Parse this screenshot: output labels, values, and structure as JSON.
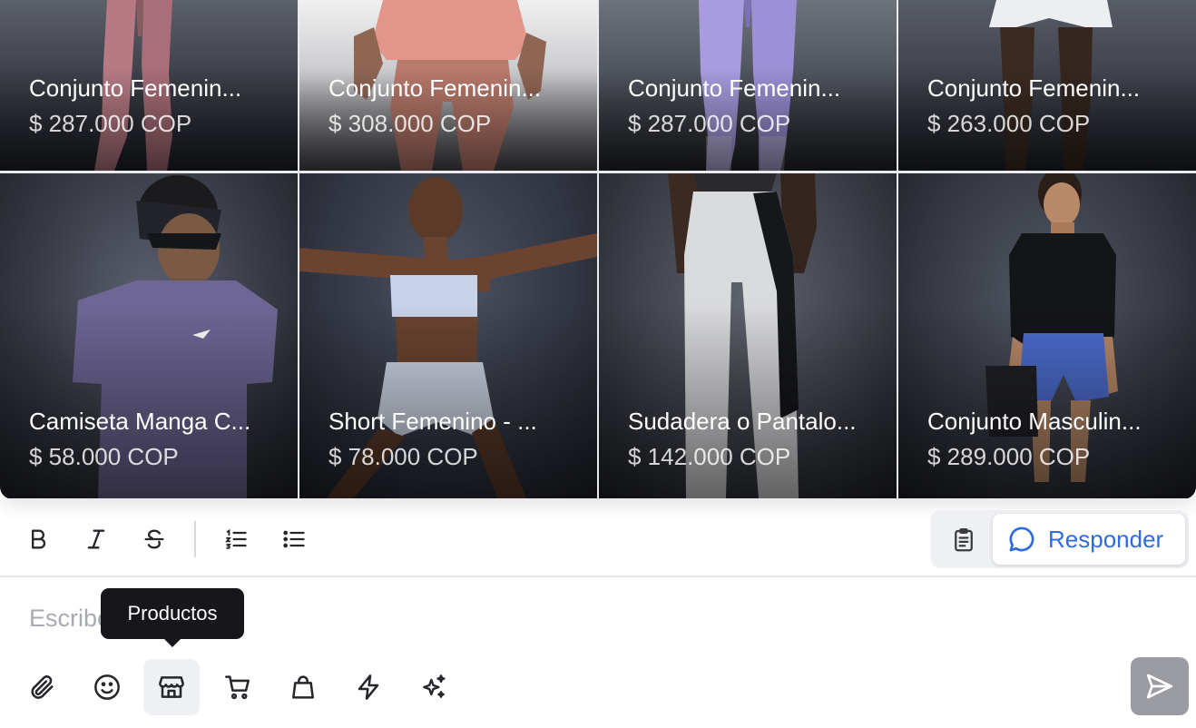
{
  "products": [
    {
      "name": "Conjunto Femenin...",
      "price": "$ 287.000 COP"
    },
    {
      "name": "Conjunto Femenin...",
      "price": "$ 308.000 COP"
    },
    {
      "name": "Conjunto Femenin...",
      "price": "$ 287.000 COP"
    },
    {
      "name": "Conjunto Femenin...",
      "price": "$ 263.000 COP"
    },
    {
      "name": "Camiseta Manga C...",
      "price": "$ 58.000 COP"
    },
    {
      "name": "Short Femenino - ...",
      "price": "$ 78.000 COP"
    },
    {
      "name": "Sudadera o Pantalo...",
      "price": "$ 142.000 COP"
    },
    {
      "name": "Conjunto Masculin...",
      "price": "$ 289.000 COP"
    }
  ],
  "toolbar": {
    "format_icons": [
      "bold-icon",
      "italic-icon",
      "strikethrough-icon",
      "numbered-list-icon",
      "bulleted-list-icon"
    ],
    "notes_icon": "clipboard-icon",
    "reply_label": "Responder",
    "reply_icon": "chat-bubble-icon"
  },
  "composer": {
    "placeholder": "Escribe un mensaje",
    "tooltip": "Productos",
    "action_icons": [
      "paperclip-icon",
      "emoji-icon",
      "store-icon",
      "cart-icon",
      "shopping-bag-icon",
      "lightning-icon",
      "sparkles-icon"
    ],
    "active_action": "store-icon",
    "send_icon": "send-icon"
  },
  "colors": {
    "accent": "#2f6be0",
    "send_bg": "#9b9ca1",
    "tooltip_bg": "#17171b",
    "active_bg": "#eef0f3"
  }
}
